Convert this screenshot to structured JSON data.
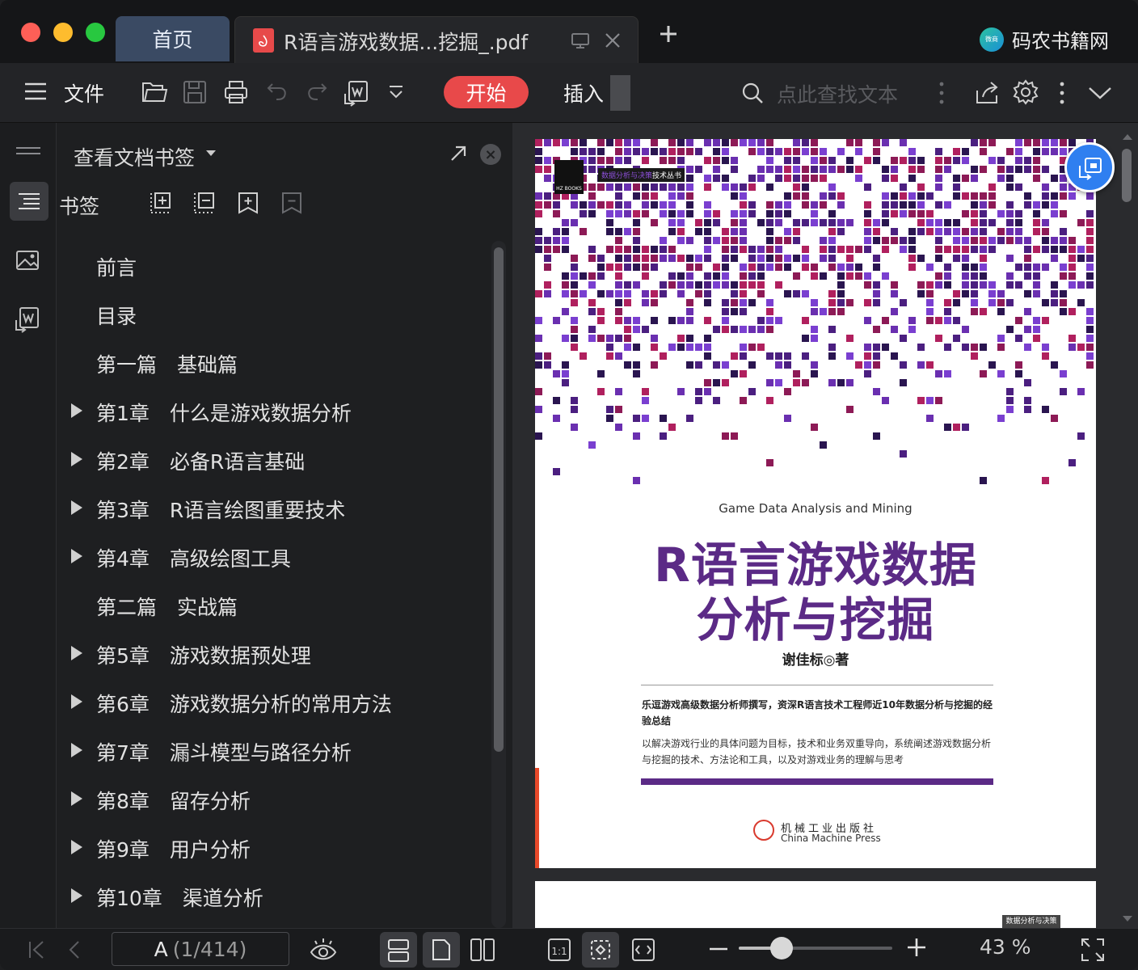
{
  "titlebar": {
    "tabs": [
      {
        "label": "首页"
      },
      {
        "label": "R语言游戏数据...挖掘_.pdf"
      }
    ],
    "brand": {
      "logo_text": "微商",
      "name": "码农书籍网"
    }
  },
  "toolbar": {
    "menu_label": "文件",
    "start_label": "开始",
    "insert_label": "插入",
    "search_placeholder": "点此查找文本",
    "more_label": ">"
  },
  "panel": {
    "title": "查看文档书签",
    "subtitle": "书签",
    "bookmarks": [
      {
        "label": "前言",
        "expandable": false
      },
      {
        "label": "目录",
        "expandable": false
      },
      {
        "label": "第一篇　基础篇",
        "expandable": false
      },
      {
        "label": "第1章　什么是游戏数据分析",
        "expandable": true
      },
      {
        "label": "第2章　必备R语言基础",
        "expandable": true
      },
      {
        "label": "第3章　R语言绘图重要技术",
        "expandable": true
      },
      {
        "label": "第4章　高级绘图工具",
        "expandable": true
      },
      {
        "label": "第二篇　实战篇",
        "expandable": false
      },
      {
        "label": "第5章　游戏数据预处理",
        "expandable": true
      },
      {
        "label": "第6章　游戏数据分析的常用方法",
        "expandable": true
      },
      {
        "label": "第7章　漏斗模型与路径分析",
        "expandable": true
      },
      {
        "label": "第8章　留存分析",
        "expandable": true
      },
      {
        "label": "第9章　用户分析",
        "expandable": true
      },
      {
        "label": "第10章　渠道分析",
        "expandable": true
      }
    ]
  },
  "cover": {
    "series": "数据分析与决策",
    "series_suffix": "技术丛书",
    "hz_logo": "HZ BOOKS",
    "en_title": "Game Data Analysis and Mining",
    "title_line1": "R语言游戏数据",
    "title_line2": "分析与挖掘",
    "author": "谢佳标◎著",
    "blurb1": "乐逗游戏高级数据分析师撰写，资深R语言技术工程师近10年数据分析与挖掘的经验总结",
    "blurb2": "以解决游戏行业的具体问题为目标，技术和业务双重导向，系统阐述游戏数据分析与挖掘的技术、方法论和工具，以及对游戏业务的理解与思考",
    "publisher_cn": "机械工业出版社",
    "publisher_en": "China Machine Press",
    "page2_badge": "数据分析与决策",
    "palette": [
      "#4b1f80",
      "#6a2fb0",
      "#8d1a56",
      "#b0205e",
      "#2a1550",
      "#7a3fd0"
    ]
  },
  "status": {
    "page_prefix": "A",
    "page_indicator": "(1/414)",
    "zoom_label": "43 %",
    "zoom_fraction": 0.28
  }
}
